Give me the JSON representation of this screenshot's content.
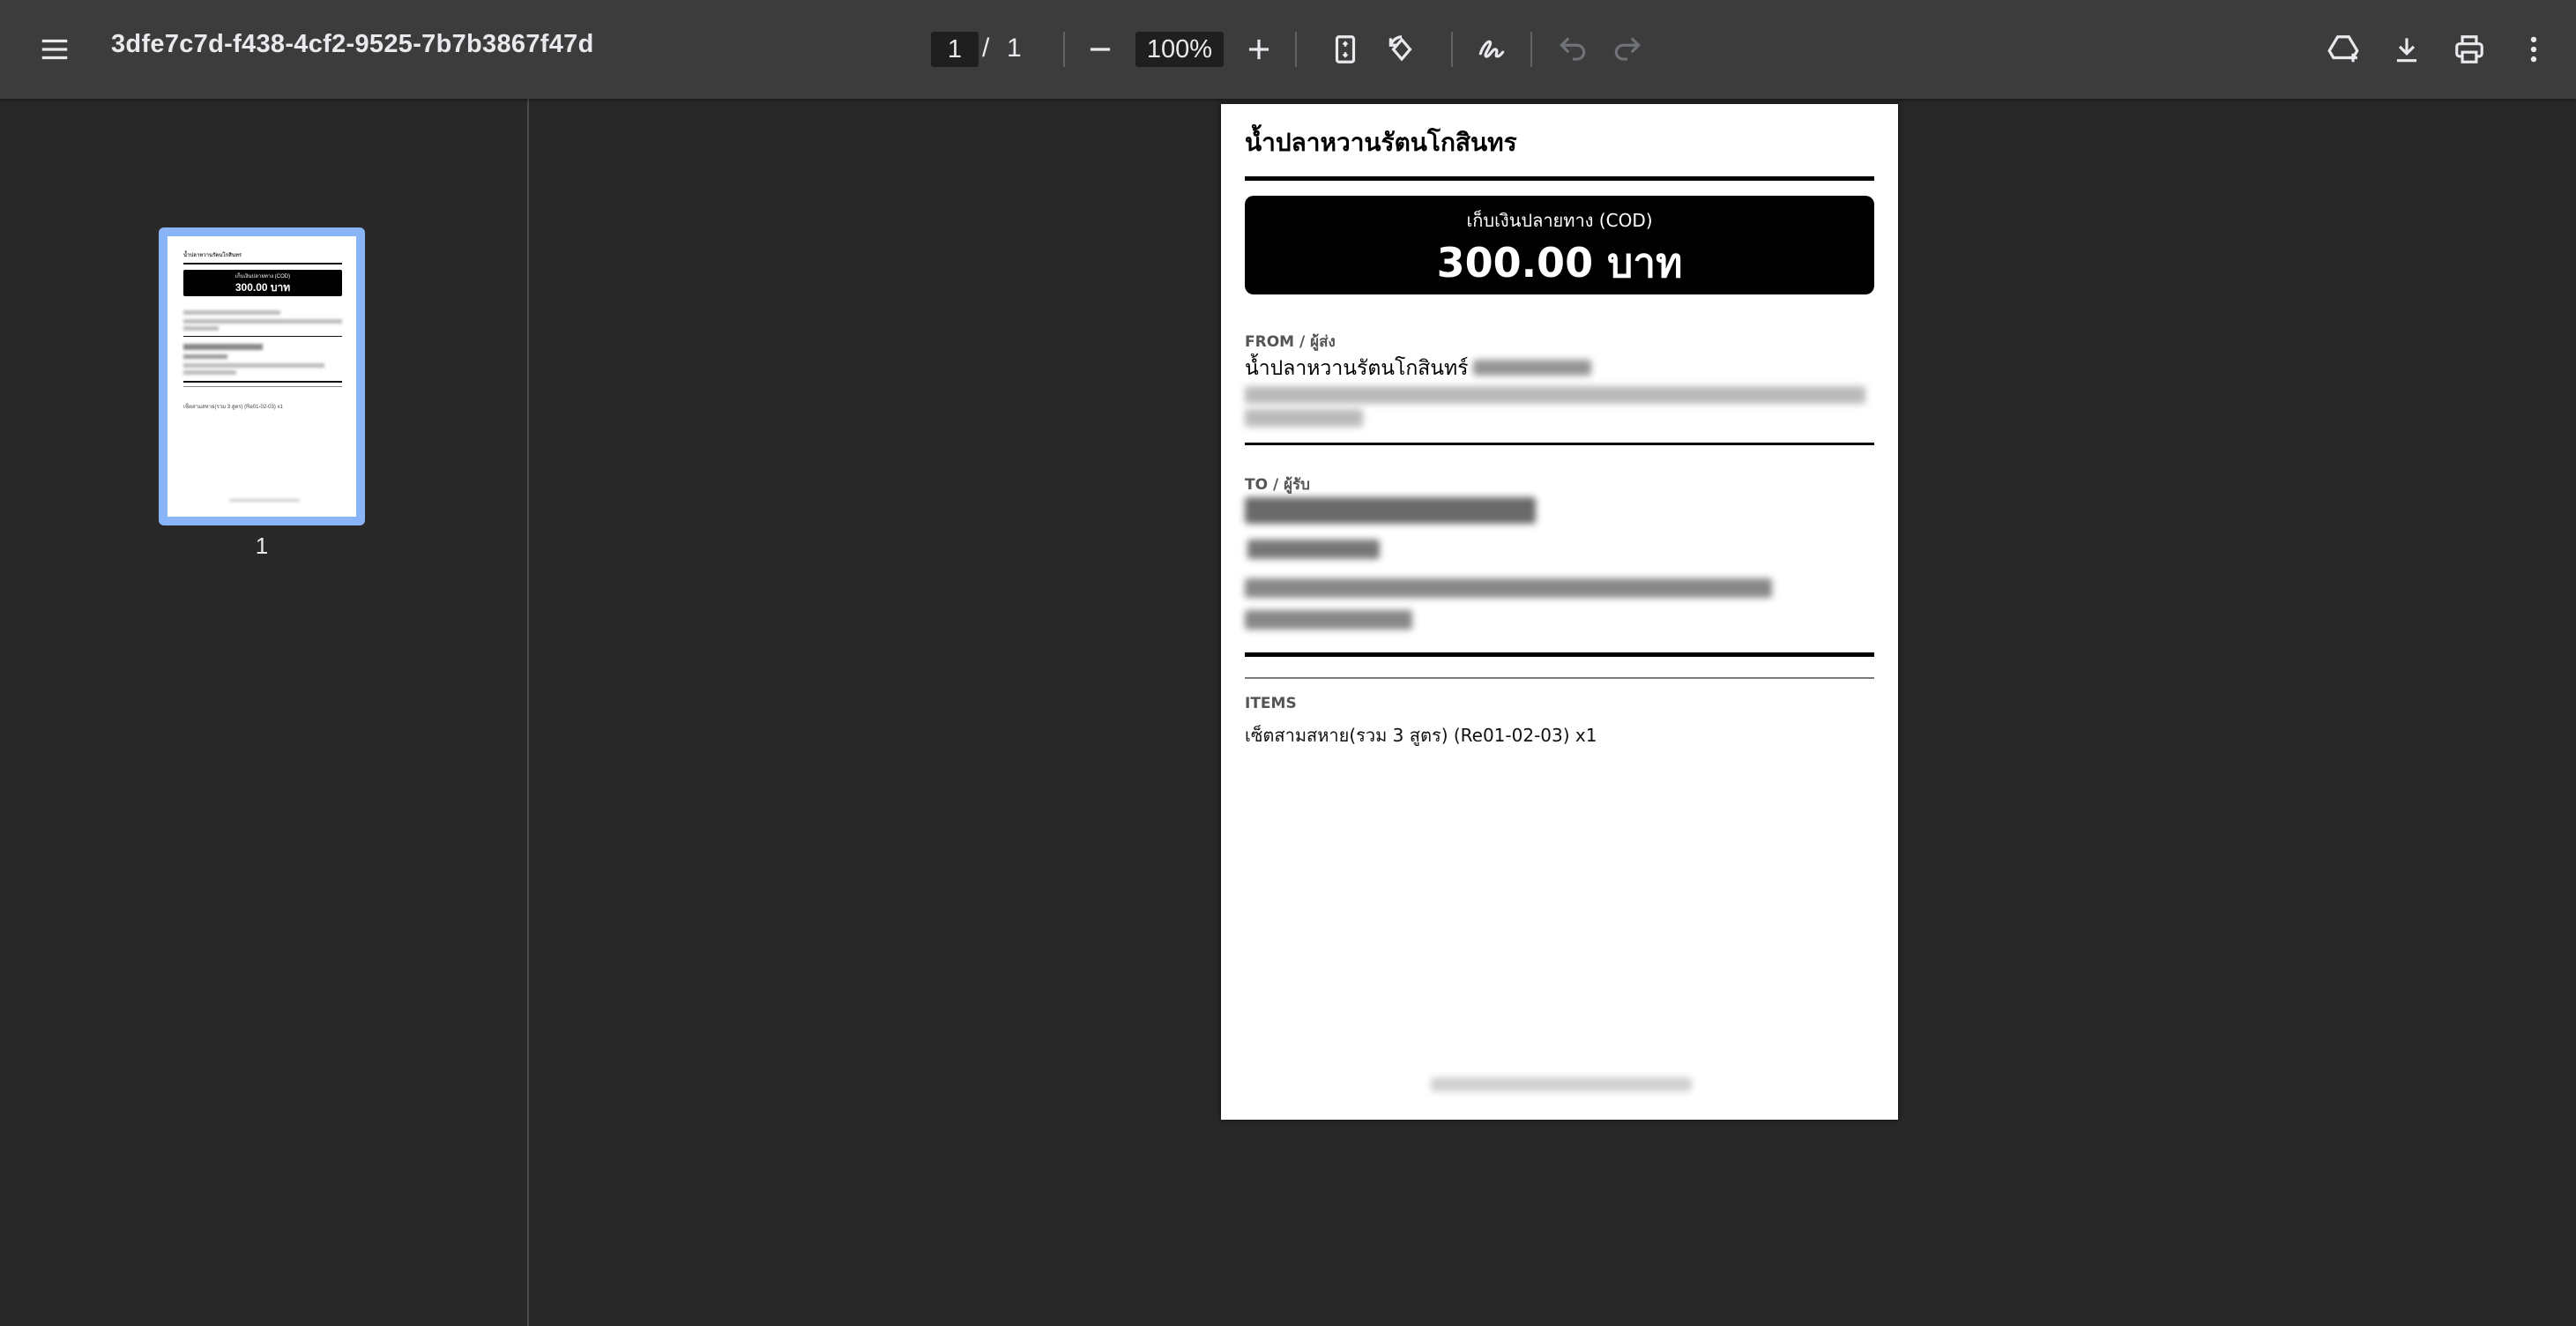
{
  "toolbar": {
    "title": "3dfe7c7d-f438-4cf2-9525-7b7b3867f47d",
    "current_page": "1",
    "page_separator": "/",
    "total_pages": "1",
    "zoom": "100%",
    "icons": [
      "menu-icon",
      "zoom-out-icon",
      "zoom-in-icon",
      "fit-page-icon",
      "rotate-icon",
      "annotate-icon",
      "undo-icon",
      "redo-icon",
      "drive-add-icon",
      "download-icon",
      "print-icon",
      "more-icon"
    ]
  },
  "sidebar": {
    "thumbnail_label": "1",
    "selected_color": "#8ab4f8"
  },
  "document": {
    "title": "น้ำปลาหวานรัตนโกสินทร",
    "cod_label": "เก็บเงินปลายทาง (COD)",
    "cod_amount": "300.00 บาท",
    "from_label": "FROM / ผู้ส่ง",
    "from_name": "น้ำปลาหวานรัตนโกสินทร์",
    "to_label": "TO / ผู้รับ",
    "items_label": "ITEMS",
    "item_line": "เซ็ตสามสหาย(รวม 3 สูตร) (Re01-02-03) x1"
  },
  "colors": {
    "toolbar_bg": "#3c3c3c",
    "viewer_bg": "#282828",
    "accent": "#8ab4f8"
  }
}
